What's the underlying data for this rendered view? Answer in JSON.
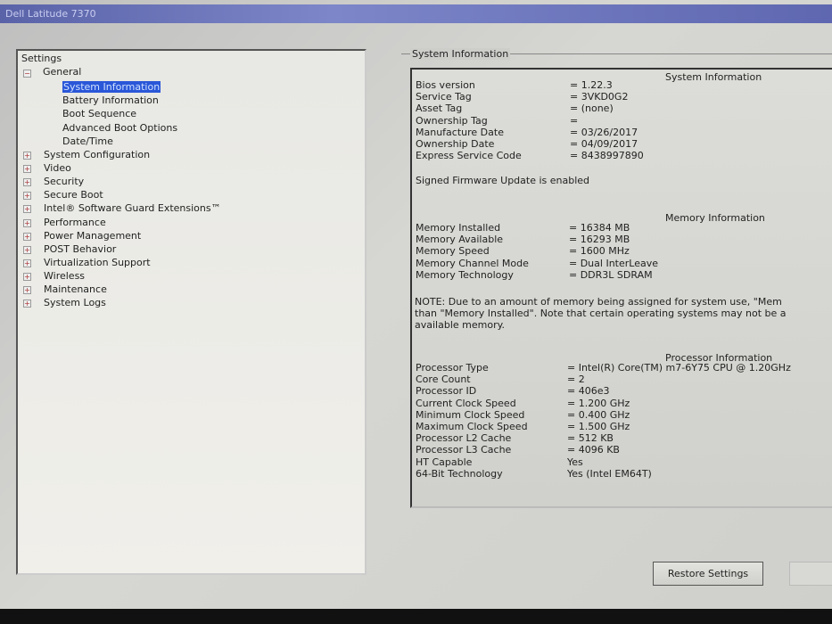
{
  "window": {
    "title": "Dell Latitude 7370"
  },
  "tree": {
    "root": "Settings",
    "general": "General",
    "general_children": [
      "System Information",
      "Battery Information",
      "Boot Sequence",
      "Advanced Boot Options",
      "Date/Time"
    ],
    "selected": "System Information",
    "collapsed": [
      "System Configuration",
      "Video",
      "Security",
      "Secure Boot",
      "Intel® Software Guard Extensions™",
      "Performance",
      "Power Management",
      "POST Behavior",
      "Virtualization Support",
      "Wireless",
      "Maintenance",
      "System Logs"
    ]
  },
  "panel": {
    "group_title": "System Information",
    "system_header": "System Information",
    "system_rows": [
      {
        "label": "Bios version",
        "value": "= 1.22.3"
      },
      {
        "label": "Service Tag",
        "value": "= 3VKD0G2"
      },
      {
        "label": "Asset Tag",
        "value": "= (none)"
      },
      {
        "label": "Ownership Tag",
        "value": "="
      },
      {
        "label": "Manufacture Date",
        "value": "= 03/26/2017"
      },
      {
        "label": "Ownership Date",
        "value": "= 04/09/2017"
      },
      {
        "label": "Express Service Code",
        "value": "= 8438997890"
      }
    ],
    "firmware_note": "Signed Firmware Update is enabled",
    "memory_header": "Memory Information",
    "memory_rows": [
      {
        "label": "Memory Installed",
        "value": "= 16384 MB"
      },
      {
        "label": "Memory Available",
        "value": "= 16293 MB"
      },
      {
        "label": "Memory Speed",
        "value": "= 1600 MHz"
      },
      {
        "label": "Memory Channel Mode",
        "value": "= Dual InterLeave"
      },
      {
        "label": "Memory Technology",
        "value": "= DDR3L SDRAM"
      }
    ],
    "memory_note": [
      "NOTE: Due to an amount of memory being assigned for system use, \"Mem",
      "than \"Memory Installed\". Note that certain operating systems may not be a",
      "available memory."
    ],
    "processor_header": "Processor Information",
    "processor_rows": [
      {
        "label": "Processor Type",
        "value": "= Intel(R) Core(TM) m7-6Y75 CPU @ 1.20GHz"
      },
      {
        "label": "Core Count",
        "value": "= 2"
      },
      {
        "label": "Processor ID",
        "value": "= 406e3"
      },
      {
        "label": "Current Clock Speed",
        "value": "= 1.200 GHz"
      },
      {
        "label": "Minimum Clock Speed",
        "value": "= 0.400 GHz"
      },
      {
        "label": "Maximum Clock Speed",
        "value": "= 1.500 GHz"
      },
      {
        "label": "Processor L2 Cache",
        "value": "= 512 KB"
      },
      {
        "label": "Processor L3 Cache",
        "value": "= 4096 KB"
      },
      {
        "label": "HT Capable",
        "value": "Yes"
      },
      {
        "label": "64-Bit Technology",
        "value": "Yes (Intel EM64T)"
      }
    ]
  },
  "buttons": {
    "restore": "Restore Settings"
  }
}
